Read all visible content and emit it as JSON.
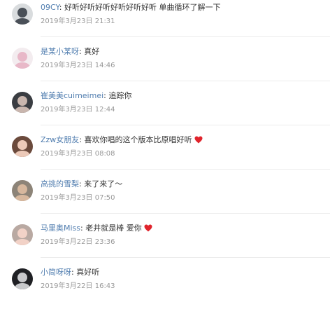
{
  "comments": [
    {
      "username": "09CY",
      "text": "好听好听好听好听好听好听 单曲循环了解一下",
      "timestamp": "2019年3月23日 21:31",
      "has_heart": false,
      "avatar": {
        "bg": "#d9dcde",
        "fg": "#4a5058",
        "icon": "avatar-icon"
      }
    },
    {
      "username": "是某小某呀",
      "text": "真好",
      "timestamp": "2019年3月23日 14:46",
      "has_heart": false,
      "avatar": {
        "bg": "#f3ecef",
        "fg": "#e8b8c8",
        "icon": "avatar-icon"
      }
    },
    {
      "username": "崔美美cuimeimei",
      "text": "追踪你",
      "timestamp": "2019年3月23日 12:44",
      "has_heart": false,
      "avatar": {
        "bg": "#3a3d42",
        "fg": "#c9b6ae",
        "icon": "avatar-icon"
      }
    },
    {
      "username": "Zzw女朋友",
      "text": "喜欢你唱的这个版本比原唱好听",
      "timestamp": "2019年3月23日 08:08",
      "has_heart": true,
      "avatar": {
        "bg": "#6b4a3c",
        "fg": "#ecc9b8",
        "icon": "avatar-icon"
      }
    },
    {
      "username": "高挑的雪梨",
      "text": "来了来了～",
      "timestamp": "2019年3月23日 07:50",
      "has_heart": false,
      "avatar": {
        "bg": "#8d8478",
        "fg": "#d7b89e",
        "icon": "avatar-icon"
      }
    },
    {
      "username": "马里奥Miss",
      "text": "老井就是棒 爱你",
      "timestamp": "2019年3月22日 23:36",
      "has_heart": true,
      "avatar": {
        "bg": "#b9a9a2",
        "fg": "#f2d2c7",
        "icon": "avatar-icon"
      }
    },
    {
      "username": "小简呀呀",
      "text": "真好听",
      "timestamp": "2019年3月22日 16:43",
      "has_heart": false,
      "avatar": {
        "bg": "#1f2024",
        "fg": "#c8c9cc",
        "icon": "avatar-icon"
      }
    }
  ],
  "labels": {
    "separator": ": "
  },
  "colors": {
    "username": "#507daf",
    "timestamp": "#999999",
    "heart": "#e0242c"
  }
}
